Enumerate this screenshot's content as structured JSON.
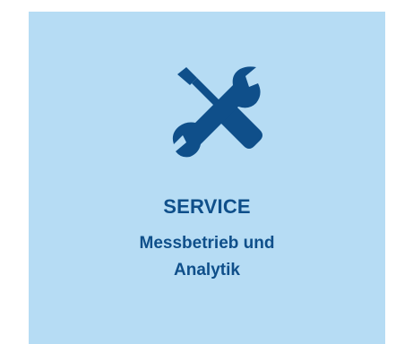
{
  "tile": {
    "title": "SERVICE",
    "subtitle_line1": "Messbetrieb und",
    "subtitle_line2": "Analytik",
    "icon": "tools-icon",
    "background_color": "#b6dcf4",
    "text_color": "#0f4f8a"
  }
}
